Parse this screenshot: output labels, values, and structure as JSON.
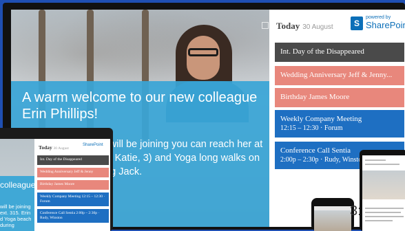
{
  "colors": {
    "background": "#1f4fb3",
    "banner": "#39a5d6",
    "event_dark": "#4a4a4a",
    "event_salmon": "#e8877c",
    "event_blue": "#1e6fc2",
    "sharepoint": "#0c6fb8"
  },
  "main_display": {
    "welcome_title": "A warm welcome to our new colleague Erin Phillips!",
    "welcome_body": "Phillips. Today, she will be joining you can reach her at ext. 315. Erin ughter Katie, 3) and Yoga long walks on the beach during dog Jack.",
    "day_label": "Today",
    "date_label": "30 August",
    "brand_small": "powered by",
    "brand_name": "SharePoint",
    "events": [
      {
        "title": "Int. Day of the Disappeared",
        "subtitle": "",
        "color": "#4a4a4a"
      },
      {
        "title": "Wedding Anniversary Jeff & Jenny...",
        "subtitle": "",
        "color": "#e8877c"
      },
      {
        "title": "Birthday James Moore",
        "subtitle": "",
        "color": "#e8877c"
      },
      {
        "title": "Weekly Company Meeting",
        "subtitle": "12:15 – 12:30 · Forum",
        "color": "#1e6fc2"
      },
      {
        "title": "Conference Call Sentia",
        "subtitle": "2:00p – 2:30p · Rudy, Winston",
        "color": "#1e6fc2"
      }
    ]
  },
  "laptop_display": {
    "welcome_title": "colleague",
    "welcome_body": "will be joining ext. 315. Erin d Yoga beach during",
    "day_label": "Today",
    "date_label": "30 August",
    "brand_name": "SharePoint",
    "events": [
      {
        "title": "Int. Day of the Disappeared",
        "color": "#4a4a4a"
      },
      {
        "title": "Wedding Anniversary Jeff & Jenny",
        "color": "#e8877c"
      },
      {
        "title": "Birthday James Moore",
        "color": "#e8877c"
      },
      {
        "title": "Weekly Company Meeting 12:15 – 12:30 · Forum",
        "color": "#1e6fc2"
      },
      {
        "title": "Conference Call Sentia 2:00p – 2:30p · Rudy, Winston",
        "color": "#1e6fc2"
      }
    ]
  },
  "clock_text": "3:2"
}
